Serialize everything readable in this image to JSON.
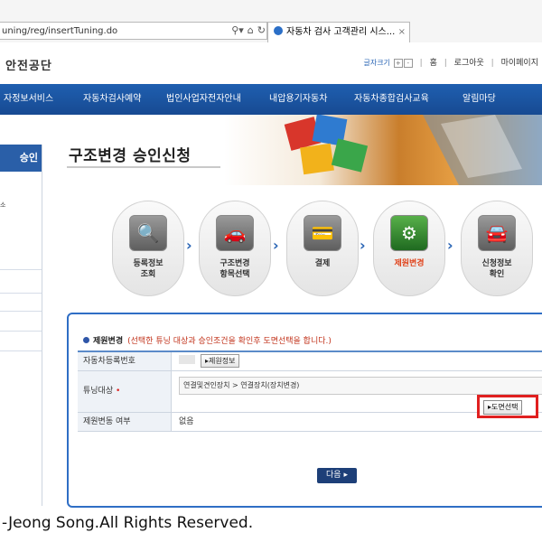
{
  "browser": {
    "url": "uning/reg/insertTuning.do",
    "addr_controls": [
      "⚲▾",
      "⌂",
      "↻"
    ],
    "tab_title": "자동차 검사 고객관리 시스...",
    "tab_close": "×"
  },
  "header": {
    "logo_text": "안전공단",
    "font_size_label": "글자크기",
    "font_size_plus": "+",
    "font_size_minus": "-",
    "links": [
      "홈",
      "로그아웃",
      "마이페이지"
    ]
  },
  "gnb": {
    "items": [
      "자정보서비스",
      "자동차검사예약",
      "법인사업자전자안내",
      "내압용기자동차",
      "자동차종합검사교육",
      "알림마당"
    ]
  },
  "lnb": {
    "title": "승인",
    "sub_item": "소"
  },
  "page": {
    "title": "구조변경 승인신청"
  },
  "steps": [
    {
      "label_line1": "등록정보",
      "label_line2": "조회",
      "icon": "magnifier-icon",
      "glyph": "🔍",
      "active": false
    },
    {
      "label_line1": "구조변경",
      "label_line2": "항목선택",
      "icon": "car-icon",
      "glyph": "🚗",
      "active": false
    },
    {
      "label_line1": "결제",
      "label_line2": "",
      "icon": "payment-icon",
      "glyph": "💳",
      "active": false
    },
    {
      "label_line1": "제원변경",
      "label_line2": "",
      "icon": "gear-icon",
      "glyph": "⚙",
      "active": true
    },
    {
      "label_line1": "신청정보",
      "label_line2": "확인",
      "icon": "car-check-icon",
      "glyph": "🚘",
      "active": false
    }
  ],
  "step_arrow": "›",
  "form": {
    "title": "제원변경",
    "note": "(선택한 튜닝 대상과 승인조건을 확인후 도면선택을 합니다.)",
    "rows": {
      "vehicle_no_label": "자동차등록번호",
      "spec_button": "제원정보",
      "tuning_target_label": "튜닝대상",
      "required_mark": "•",
      "tuning_target_value": "연결및견인장치 > 연결장치(장치변경)",
      "drawing_select_button": "도면선택",
      "spec_change_label": "제원변동 여부",
      "spec_change_value": "없음"
    },
    "next_button": "다음"
  },
  "footer": {
    "copyright": "-Jeong Song.All Rights Reserved."
  }
}
